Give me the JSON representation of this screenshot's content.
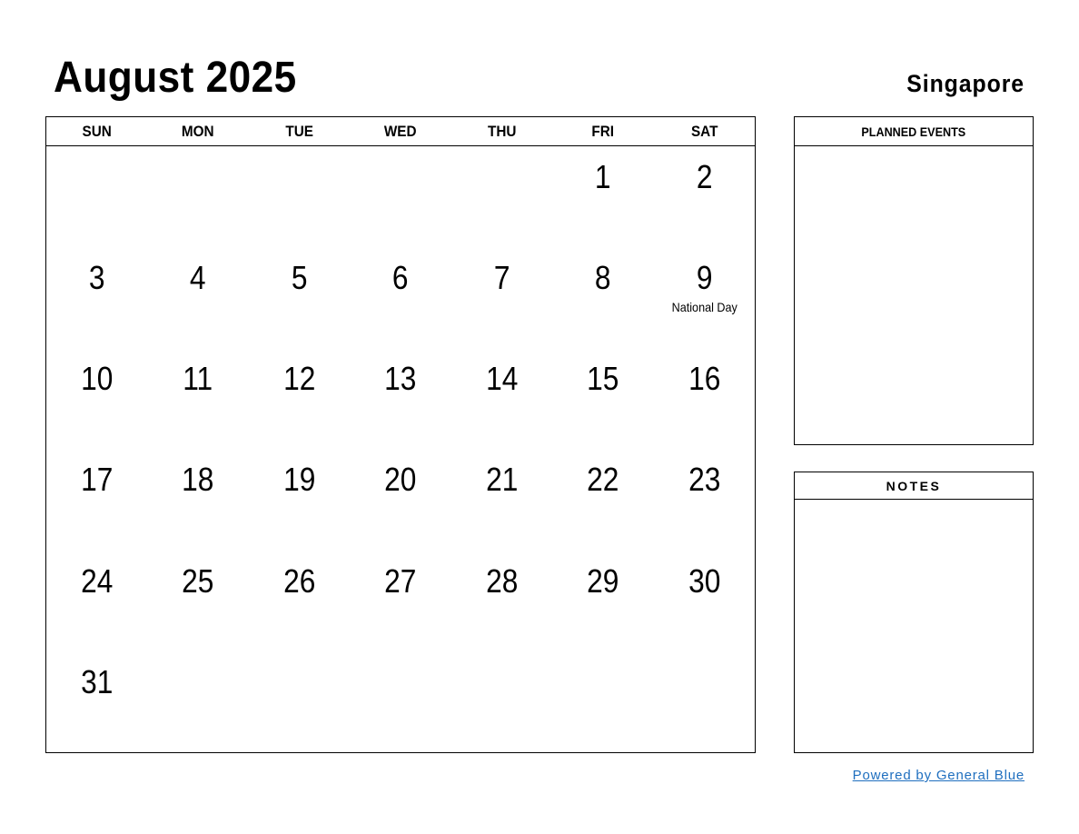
{
  "header": {
    "title": "August 2025",
    "country": "Singapore"
  },
  "calendar": {
    "weekdays": [
      "SUN",
      "MON",
      "TUE",
      "WED",
      "THU",
      "FRI",
      "SAT"
    ],
    "weeks": [
      [
        {
          "day": ""
        },
        {
          "day": ""
        },
        {
          "day": ""
        },
        {
          "day": ""
        },
        {
          "day": ""
        },
        {
          "day": "1"
        },
        {
          "day": "2"
        }
      ],
      [
        {
          "day": "3"
        },
        {
          "day": "4"
        },
        {
          "day": "5"
        },
        {
          "day": "6"
        },
        {
          "day": "7"
        },
        {
          "day": "8"
        },
        {
          "day": "9",
          "holiday": "National Day"
        }
      ],
      [
        {
          "day": "10"
        },
        {
          "day": "11"
        },
        {
          "day": "12"
        },
        {
          "day": "13"
        },
        {
          "day": "14"
        },
        {
          "day": "15"
        },
        {
          "day": "16"
        }
      ],
      [
        {
          "day": "17"
        },
        {
          "day": "18"
        },
        {
          "day": "19"
        },
        {
          "day": "20"
        },
        {
          "day": "21"
        },
        {
          "day": "22"
        },
        {
          "day": "23"
        }
      ],
      [
        {
          "day": "24"
        },
        {
          "day": "25"
        },
        {
          "day": "26"
        },
        {
          "day": "27"
        },
        {
          "day": "28"
        },
        {
          "day": "29"
        },
        {
          "day": "30"
        }
      ],
      [
        {
          "day": "31"
        },
        {
          "day": ""
        },
        {
          "day": ""
        },
        {
          "day": ""
        },
        {
          "day": ""
        },
        {
          "day": ""
        },
        {
          "day": ""
        }
      ]
    ]
  },
  "planned_events": {
    "title": "PLANNED EVENTS"
  },
  "notes": {
    "title": "NOTES"
  },
  "footer": {
    "link_text": "Powered by General Blue",
    "link_color": "#1f6fbf"
  }
}
